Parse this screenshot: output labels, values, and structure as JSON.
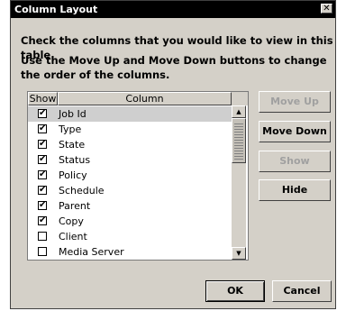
{
  "dialog": {
    "title": "Column Layout",
    "close_glyph": "✕",
    "instruction_1": "Check the columns that you would like to view in this table.",
    "instruction_2": "Use the Move Up and Move Down buttons to change the order of the columns."
  },
  "table": {
    "headers": {
      "show": "Show",
      "column": "Column"
    },
    "rows": [
      {
        "label": "Job Id",
        "checked": true,
        "selected": true
      },
      {
        "label": "Type",
        "checked": true,
        "selected": false
      },
      {
        "label": "State",
        "checked": true,
        "selected": false
      },
      {
        "label": "Status",
        "checked": true,
        "selected": false
      },
      {
        "label": "Policy",
        "checked": true,
        "selected": false
      },
      {
        "label": "Schedule",
        "checked": true,
        "selected": false
      },
      {
        "label": "Parent",
        "checked": true,
        "selected": false
      },
      {
        "label": "Copy",
        "checked": true,
        "selected": false
      },
      {
        "label": "Client",
        "checked": false,
        "selected": false
      },
      {
        "label": "Media Server",
        "checked": false,
        "selected": false
      }
    ],
    "check_glyph": "✔",
    "scroll_up_glyph": "▲",
    "scroll_down_glyph": "▼"
  },
  "buttons": {
    "move_up": "Move Up",
    "move_down": "Move Down",
    "show": "Show",
    "hide": "Hide",
    "ok": "OK",
    "cancel": "Cancel"
  }
}
